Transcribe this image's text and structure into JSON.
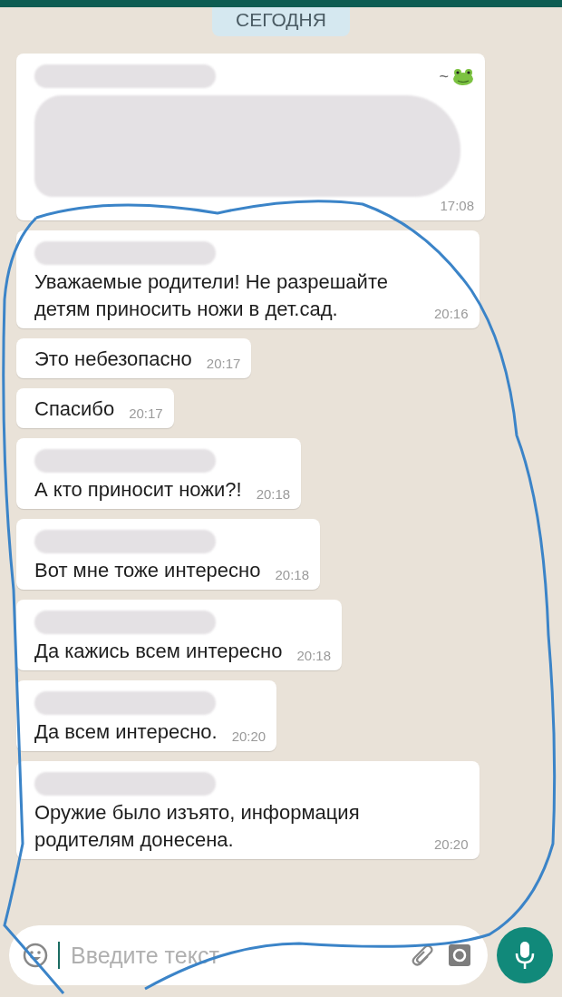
{
  "date_chip": "СЕГОДНЯ",
  "messages": [
    {
      "kind": "redacted",
      "sender": "~",
      "sender_redacted": true,
      "time": "17:08"
    },
    {
      "kind": "text",
      "sender_redacted": true,
      "text": "Уважаемые родители! Не разрешайте детям приносить ножи в дет.сад.",
      "time": "20:16"
    },
    {
      "kind": "text",
      "sender_redacted": false,
      "text": "Это небезопасно",
      "time": "20:17"
    },
    {
      "kind": "text",
      "sender_redacted": false,
      "text": "Спасибо",
      "time": "20:17"
    },
    {
      "kind": "text",
      "sender_redacted": true,
      "text": "А кто приносит ножи?!",
      "time": "20:18"
    },
    {
      "kind": "text",
      "sender_redacted": true,
      "text": "Вот мне тоже интересно",
      "time": "20:18"
    },
    {
      "kind": "text",
      "sender_redacted": true,
      "text": "Да кажись всем интересно",
      "time": "20:18"
    },
    {
      "kind": "text",
      "sender_redacted": true,
      "text": "Да всем интересно.",
      "time": "20:20"
    },
    {
      "kind": "text",
      "sender_redacted": true,
      "text": "Оружие было изъято, информация родителям донесена.",
      "time": "20:20"
    }
  ],
  "composer": {
    "placeholder": "Введите текст"
  }
}
